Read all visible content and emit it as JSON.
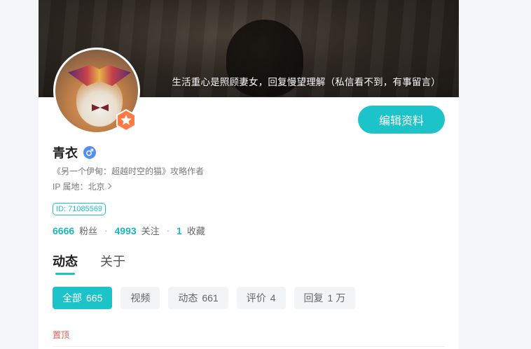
{
  "profile": {
    "signature": "生活重心是照顾妻女，回复慢望理解（私信看不到，有事留言）",
    "edit_button": "编辑资料",
    "name": "青衣",
    "gender_icon": "male-icon",
    "title": "《另一个伊甸：超越时空的猫》攻略作者",
    "ip_location": "IP 属地：北京",
    "uid": "ID: 71085569"
  },
  "stats": {
    "fans_count": "6666",
    "fans_label": "粉丝",
    "following_count": "4993",
    "following_label": "关注",
    "favorites_count": "1",
    "favorites_label": "收藏",
    "separator": "·"
  },
  "tabs": [
    {
      "label": "动态",
      "active": true
    },
    {
      "label": "关于",
      "active": false
    }
  ],
  "filters": [
    {
      "label": "全部",
      "count": "665",
      "active": true
    },
    {
      "label": "视频",
      "count": "",
      "active": false
    },
    {
      "label": "动态",
      "count": "661",
      "active": false
    },
    {
      "label": "评价",
      "count": "4",
      "active": false
    },
    {
      "label": "回复",
      "count": "1 万",
      "active": false
    }
  ],
  "feed": {
    "pinned_label": "置顶"
  },
  "colors": {
    "accent": "#1cc3c9",
    "badge": "#ff7a45",
    "gender": "#4f8ef7",
    "pinned": "#e45a4f"
  }
}
